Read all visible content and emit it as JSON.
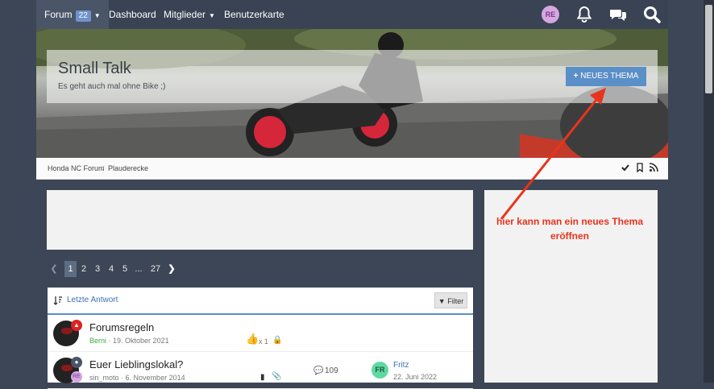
{
  "nav": {
    "forum_label": "Forum",
    "forum_badge": "22",
    "dashboard_label": "Dashboard",
    "members_label": "Mitglieder",
    "map_label": "Benutzerkarte",
    "avatar_initials": "RE"
  },
  "hero": {
    "title": "Small Talk",
    "subtitle": "Es geht auch mal ohne Bike ;)",
    "new_thread_label": "NEUES THEMA"
  },
  "breadcrumb": [
    "Honda NC Forum",
    "Plauderecke"
  ],
  "pager": {
    "pages": [
      "1",
      "2",
      "3",
      "4",
      "5",
      "...",
      "27"
    ],
    "current": "1"
  },
  "threads_header": {
    "sort_label": "Letzte Antwort",
    "filter_label": "Filter"
  },
  "threads": [
    {
      "title": "Forumsregeln",
      "author": "Berni",
      "date": "19. Oktober 2021",
      "likes": "x 1"
    },
    {
      "title": "Euer Lieblingslokal?",
      "author": "sin_moto",
      "date": "6. November 2014",
      "replies": "109",
      "last_user": "Fritz",
      "last_user_initials": "FR",
      "last_date": "22. Juni 2022",
      "author_initials": "RE"
    }
  ],
  "annotation": "hier kann man ein neues Thema eröffnen",
  "colors": {
    "accent": "#5b8fc7",
    "nav_bg": "#394354",
    "annotation": "#e8341c"
  }
}
